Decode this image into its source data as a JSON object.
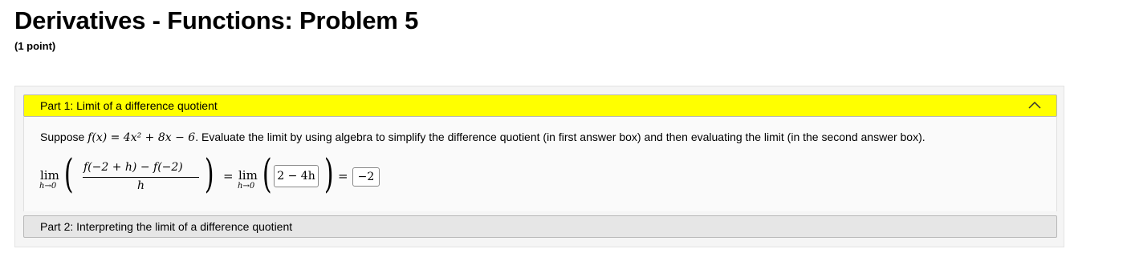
{
  "page": {
    "title": "Derivatives - Functions: Problem 5",
    "points": "(1 point)"
  },
  "part1": {
    "header": "Part 1: Limit of a difference quotient",
    "text_prefix": "Suppose ",
    "function_expr": "f(x) = 4x² + 8x − 6",
    "text_suffix": ". Evaluate the limit by using algebra to simplify the difference quotient (in first answer box) and then evaluating the limit (in the second answer box).",
    "lim_label": "lim",
    "lim_sub": "h→0",
    "numerator": "f(−2 + h) − f(−2)",
    "denominator": "h",
    "equals": "=",
    "answer1": "2 − 4h",
    "answer2": "−2"
  },
  "part2": {
    "header": "Part 2: Interpreting the limit of a difference quotient"
  },
  "colors": {
    "part1_header_bg": "#ffff00",
    "part2_header_bg": "#e6e6e6"
  },
  "icons": {
    "collapse": "chevron-up-icon"
  }
}
